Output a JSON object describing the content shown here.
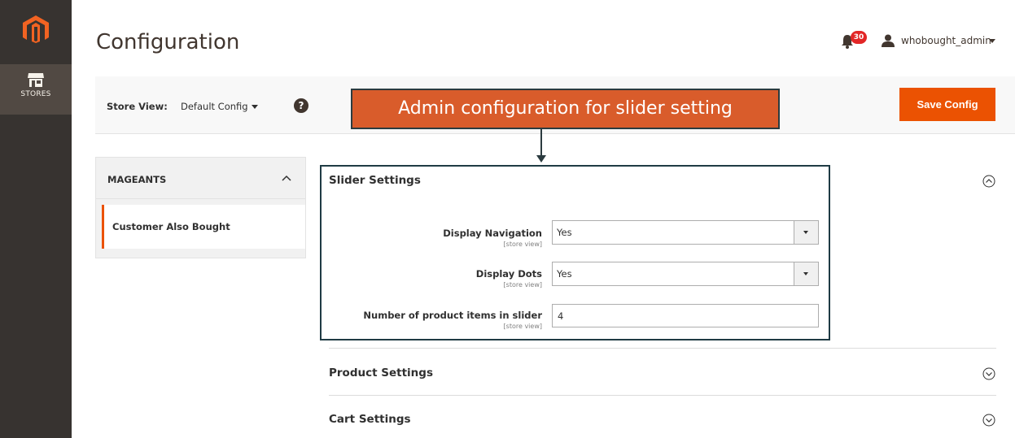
{
  "nav": {
    "stores_label": "STORES"
  },
  "header": {
    "title": "Configuration",
    "notifications_count": "30",
    "username": "whobought_admin"
  },
  "store_view": {
    "label": "Store View:",
    "value": "Default Config",
    "help_glyph": "?"
  },
  "actions": {
    "save_label": "Save Config"
  },
  "annotation": {
    "text": "Admin configuration for slider setting"
  },
  "sidebar": {
    "group_label": "MAGEANTS",
    "items": [
      {
        "label": "Customer Also Bought"
      }
    ]
  },
  "sections": {
    "slider": {
      "title": "Slider Settings",
      "fields": {
        "display_navigation": {
          "label": "Display Navigation",
          "scope": "[store view]",
          "value": "Yes"
        },
        "display_dots": {
          "label": "Display Dots",
          "scope": "[store view]",
          "value": "Yes"
        },
        "items_count": {
          "label": "Number of product items in slider",
          "scope": "[store view]",
          "value": "4"
        }
      }
    },
    "product": {
      "title": "Product Settings"
    },
    "cart": {
      "title": "Cart Settings"
    }
  },
  "colors": {
    "accent": "#eb5202",
    "nav_bg": "#373330",
    "callout_bg": "#d95c2b"
  }
}
